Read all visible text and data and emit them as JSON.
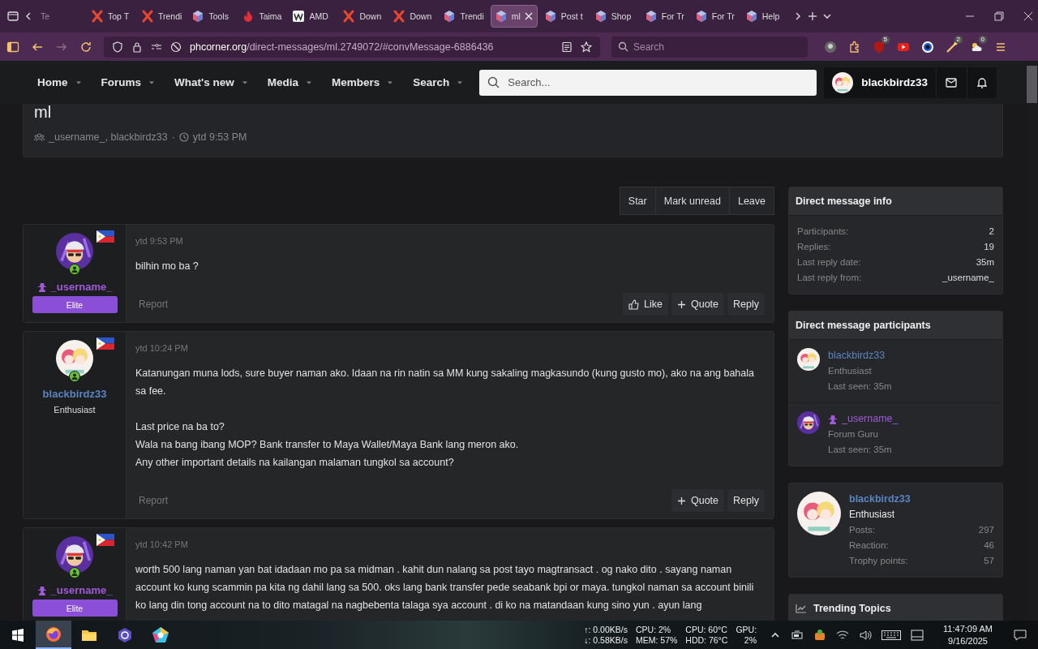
{
  "browser": {
    "tabs": [
      {
        "label": "Te",
        "kind": "blank",
        "selected": false
      },
      {
        "label": "Top T",
        "kind": "x",
        "selected": false
      },
      {
        "label": "Trendi",
        "kind": "x",
        "selected": false
      },
      {
        "label": "Tools",
        "kind": "cube",
        "selected": false
      },
      {
        "label": "Taima",
        "kind": "flame",
        "selected": false
      },
      {
        "label": "AMD",
        "kind": "wiki",
        "selected": false
      },
      {
        "label": "Down",
        "kind": "x",
        "selected": false
      },
      {
        "label": "Down",
        "kind": "x",
        "selected": false
      },
      {
        "label": "Trendi",
        "kind": "cube",
        "selected": false
      },
      {
        "label": "ml",
        "kind": "cube",
        "selected": true
      },
      {
        "label": "Post t",
        "kind": "cube",
        "selected": false
      },
      {
        "label": "Shop",
        "kind": "cube",
        "selected": false
      },
      {
        "label": "For Tr",
        "kind": "cube",
        "selected": false
      },
      {
        "label": "For Tr",
        "kind": "cube",
        "selected": false
      },
      {
        "label": "Help",
        "kind": "cube",
        "selected": false
      }
    ],
    "url_host": "phcorner.org",
    "url_path": "/direct-messages/ml.2749072/#convMessage-6886436",
    "search_placeholder": "Search",
    "extension_badges": [
      "5",
      "2",
      "0"
    ]
  },
  "site_nav": {
    "items": [
      "Home",
      "Forums",
      "What's new",
      "Media",
      "Members",
      "Search"
    ],
    "search_placeholder": "Search...",
    "account": "blackbirdz33"
  },
  "thread": {
    "title": "ml",
    "participants": "_username_, blackbirdz33",
    "separator": "·",
    "time": "ytd 9:53 PM",
    "actions": [
      "Star",
      "Mark unread",
      "Leave"
    ]
  },
  "posts": [
    {
      "kind": "elite",
      "author": "_username_",
      "rank": "Elite",
      "time": "ytd 9:53 PM",
      "paragraphs": [
        [
          "bilhin mo ba ?"
        ]
      ],
      "report": "Report",
      "actions": [
        {
          "kind": "like",
          "label": "Like"
        },
        {
          "kind": "quote",
          "label": "Quote"
        },
        {
          "kind": "reply",
          "label": "Reply"
        }
      ]
    },
    {
      "kind": "member",
      "author": "blackbirdz33",
      "rank": "Enthusiast",
      "time": "ytd 10:24 PM",
      "paragraphs": [
        [
          "Katanungan muna lods, sure buyer naman ako. Idaan na rin natin sa MM kung sakaling magkasundo (kung gusto mo), ako na ang bahala sa fee."
        ],
        [
          "Last price na ba to?",
          "Wala na bang ibang MOP? Bank transfer to Maya Wallet/Maya Bank lang meron ako.",
          "Any other important details na kailangan malaman tungkol sa account?"
        ]
      ],
      "report": "Report",
      "actions": [
        {
          "kind": "quote",
          "label": "Quote"
        },
        {
          "kind": "reply",
          "label": "Reply"
        }
      ]
    },
    {
      "kind": "elite",
      "author": "_username_",
      "rank": "Elite",
      "time": "ytd 10:42 PM",
      "paragraphs": [
        [
          "worth 500 lang naman yan bat idadaan mo pa sa midman . kahit dun nalang sa post tayo magtransact . og nako dito . sayang naman account ko kung scammin pa kita ng dahil lang sa 500. oks lang bank transfer pede seabank bpi or maya. tungkol naman sa account binili ko lang din tong account na to dito matagal na nagbebenta talaga sya account . di ko na matandaan kung sino yun . ayun lang"
        ]
      ]
    }
  ],
  "sidebar": {
    "info": {
      "title": "Direct message info",
      "rows": [
        {
          "label": "Participants:",
          "value": "2"
        },
        {
          "label": "Replies:",
          "value": "19"
        },
        {
          "label": "Last reply date:",
          "value": "35m"
        },
        {
          "label": "Last reply from:",
          "value": "_username_"
        }
      ]
    },
    "participants": {
      "title": "Direct message participants",
      "people": [
        {
          "kind": "member",
          "name": "blackbirdz33",
          "rank": "Enthusiast",
          "seen": "Last seen: 35m"
        },
        {
          "kind": "elite",
          "name": "_username_",
          "rank": "Forum Guru",
          "seen": "Last seen: 35m"
        }
      ]
    },
    "profile": {
      "name": "blackbirdz33",
      "rank": "Enthusiast",
      "stats": [
        {
          "label": "Posts:",
          "value": "297"
        },
        {
          "label": "Reaction:",
          "value": "46"
        },
        {
          "label": "Trophy points:",
          "value": "57"
        }
      ]
    },
    "trending": {
      "title": "Trending Topics"
    }
  },
  "taskbar": {
    "net_up": "↑: 0.00KB/s",
    "net_down": "↓: 0.58KB/s",
    "cpu": "CPU: 2%",
    "mem": "MEM: 57%",
    "cpu_temp": "CPU: 60°C",
    "hdd_temp": "HDD: 76°C",
    "gpu": "GPU:",
    "gpu_value": "2%",
    "time": "11:47:09 AM",
    "date": "9/16/2025"
  }
}
